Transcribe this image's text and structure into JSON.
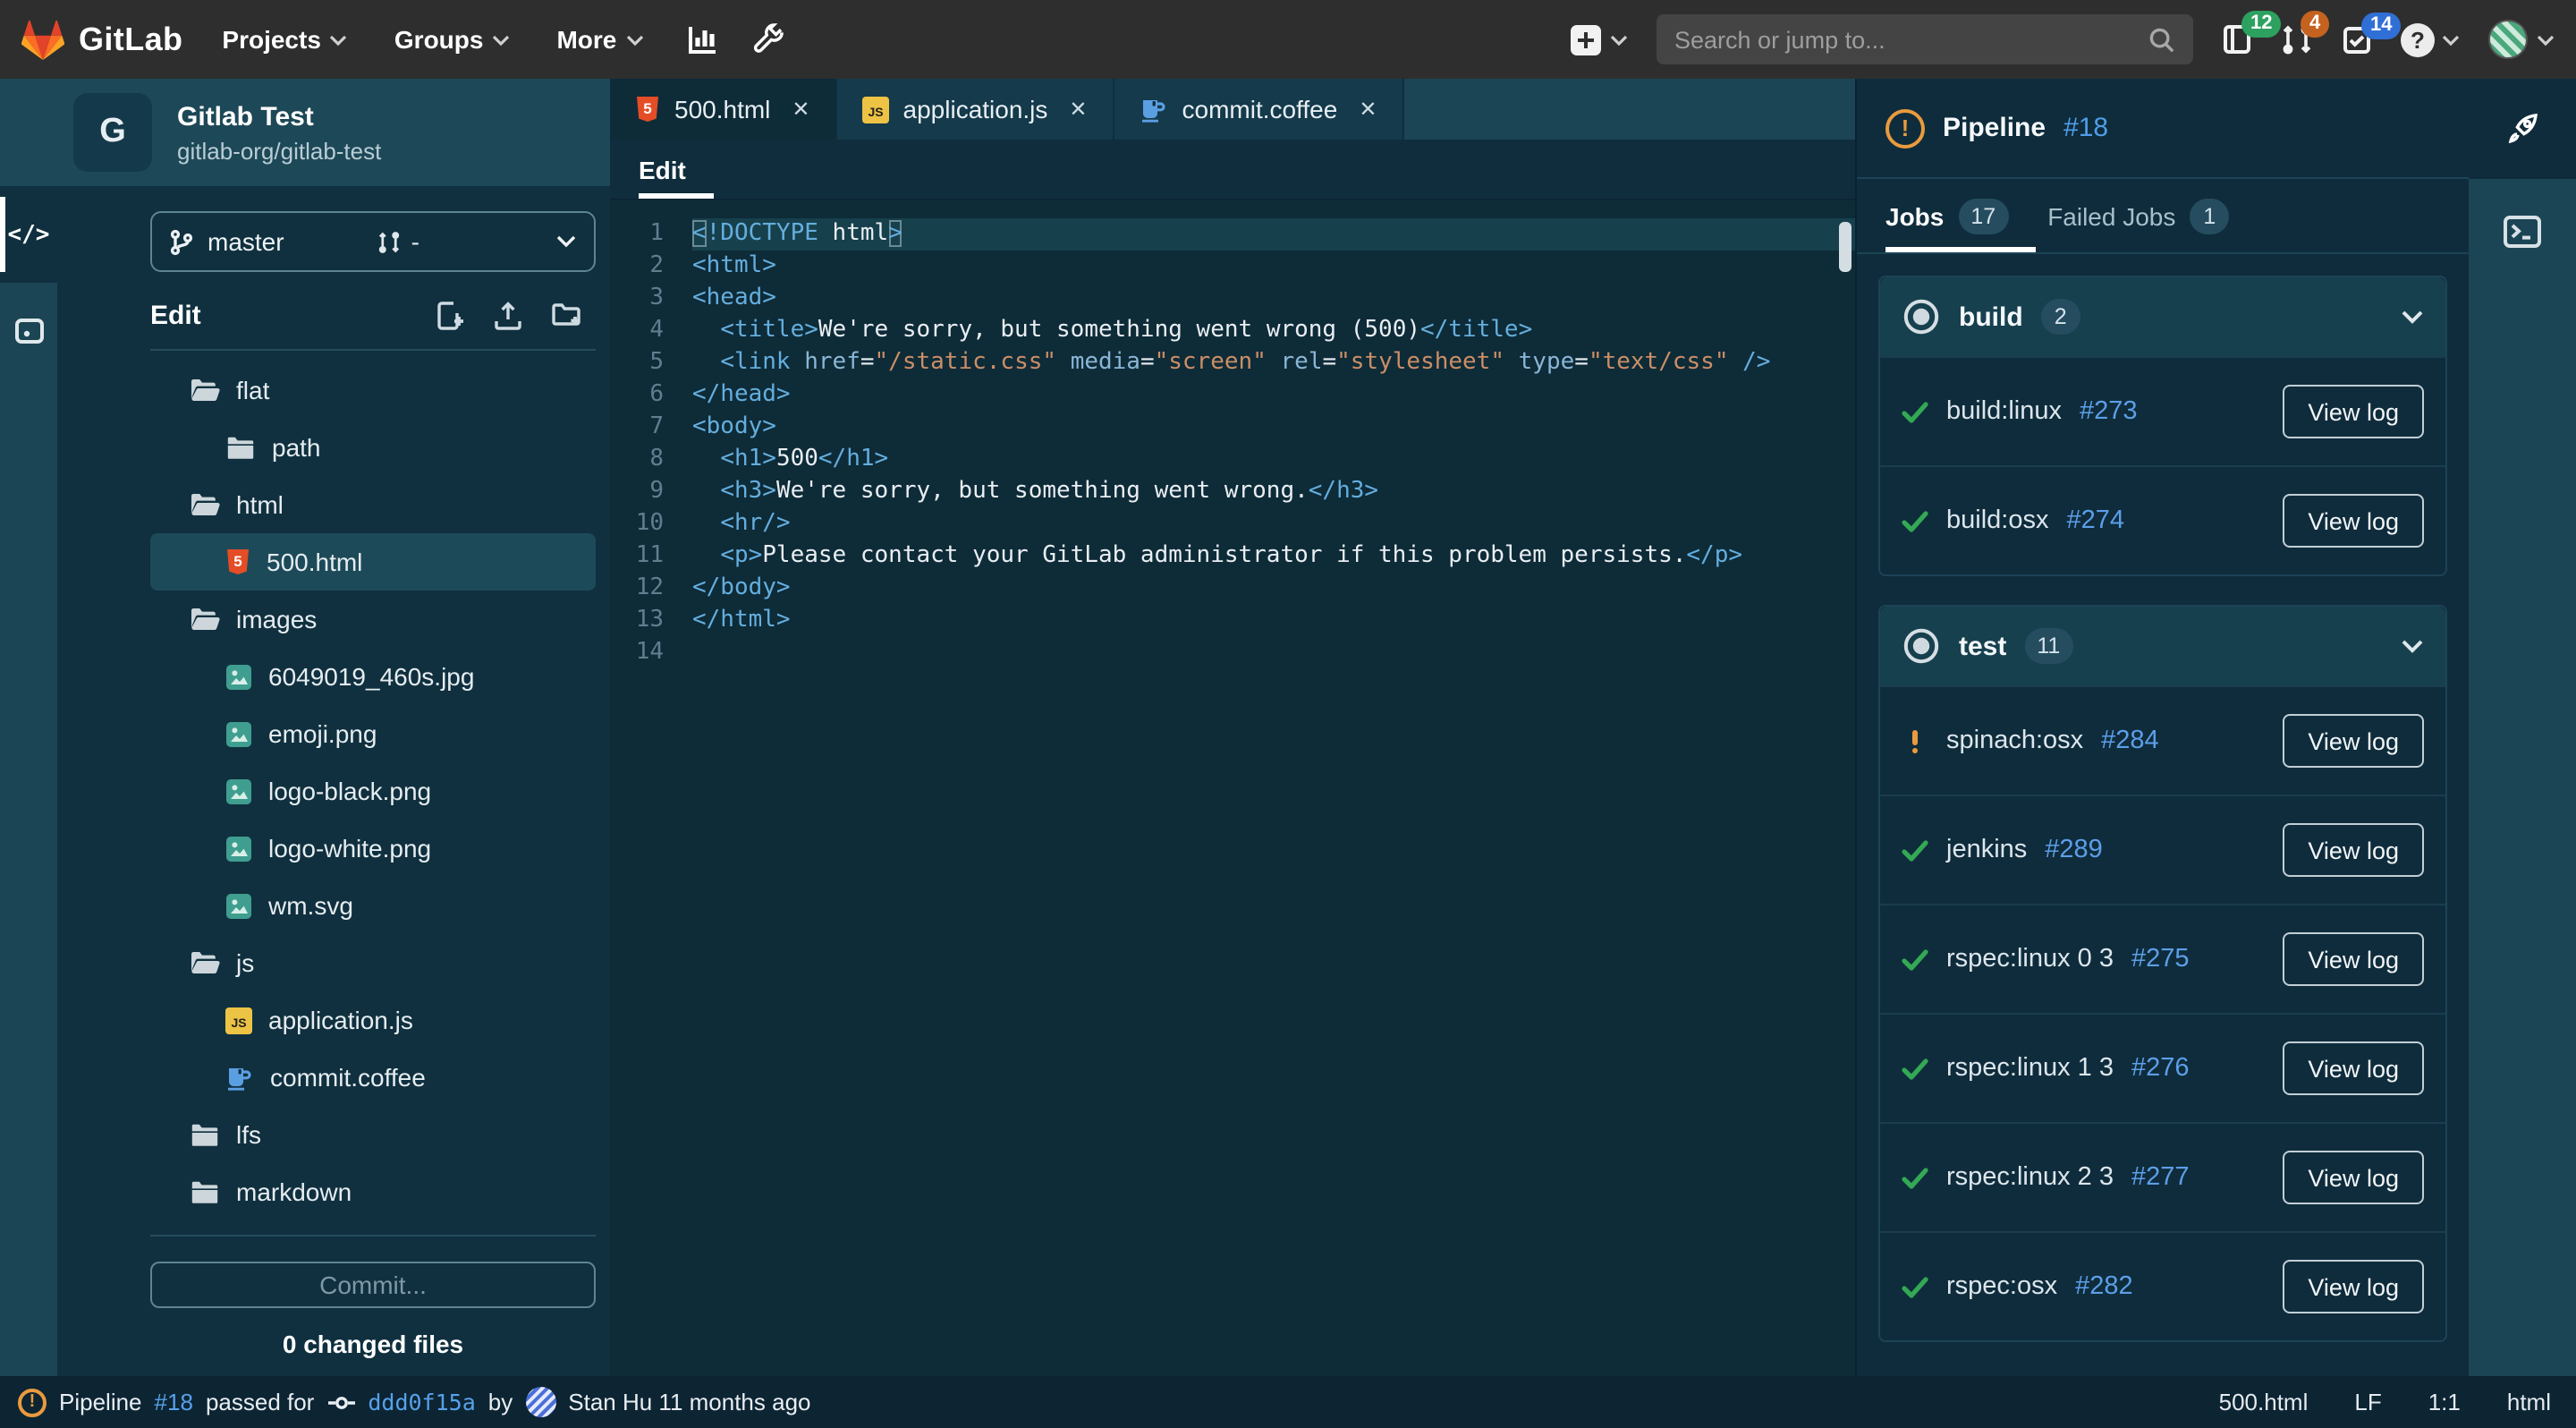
{
  "colors": {
    "topnav_bg": "#2e2e2e",
    "panel_dark": "#0f2c3c",
    "panel_teal": "#1b4554",
    "editor_bg": "#0e2b38",
    "selected_row": "#1d4a59",
    "link_blue": "#5c9fe8",
    "success_green": "#33a954",
    "warning_orange": "#e99b3d",
    "badge_green": "#2da160",
    "badge_orange": "#c4621f",
    "badge_blue": "#306fd6",
    "html5_orange": "#e44d26",
    "js_yellow": "#ecc344",
    "coffee_blue": "#5b9fe3",
    "image_teal": "#3f9e8f"
  },
  "topnav": {
    "brand": "GitLab",
    "menus": [
      {
        "label": "Projects"
      },
      {
        "label": "Groups"
      },
      {
        "label": "More"
      }
    ],
    "search_placeholder": "Search or jump to...",
    "issues_count": "12",
    "mr_count": "4",
    "todo_count": "14"
  },
  "project": {
    "initial": "G",
    "name": "Gitlab Test",
    "path": "gitlab-org/gitlab-test"
  },
  "branch": {
    "name": "master",
    "mr_value": "-"
  },
  "sidebar": {
    "edit_label": "Edit",
    "commit_button": "Commit...",
    "changed_files": "0 changed files"
  },
  "tree": [
    {
      "icon": "folder-open",
      "label": "flat",
      "indent": 0,
      "selected": false
    },
    {
      "icon": "folder",
      "label": "path",
      "indent": 1,
      "selected": false
    },
    {
      "icon": "folder-open",
      "label": "html",
      "indent": 0,
      "selected": false
    },
    {
      "icon": "html5",
      "label": "500.html",
      "indent": 1,
      "selected": true
    },
    {
      "icon": "folder-open",
      "label": "images",
      "indent": 0,
      "selected": false
    },
    {
      "icon": "image",
      "label": "6049019_460s.jpg",
      "indent": 1,
      "selected": false
    },
    {
      "icon": "image",
      "label": "emoji.png",
      "indent": 1,
      "selected": false
    },
    {
      "icon": "image",
      "label": "logo-black.png",
      "indent": 1,
      "selected": false
    },
    {
      "icon": "image",
      "label": "logo-white.png",
      "indent": 1,
      "selected": false
    },
    {
      "icon": "image",
      "label": "wm.svg",
      "indent": 1,
      "selected": false
    },
    {
      "icon": "folder-open",
      "label": "js",
      "indent": 0,
      "selected": false
    },
    {
      "icon": "js",
      "label": "application.js",
      "indent": 1,
      "selected": false
    },
    {
      "icon": "coffee",
      "label": "commit.coffee",
      "indent": 1,
      "selected": false
    },
    {
      "icon": "folder",
      "label": "lfs",
      "indent": 0,
      "selected": false
    },
    {
      "icon": "folder",
      "label": "markdown",
      "indent": 0,
      "selected": false
    }
  ],
  "tabs": [
    {
      "icon": "html5",
      "label": "500.html",
      "close": "✕",
      "active": true
    },
    {
      "icon": "js",
      "label": "application.js",
      "close": "✕",
      "active": false
    },
    {
      "icon": "coffee",
      "label": "commit.coffee",
      "close": "✕",
      "active": false
    }
  ],
  "editor": {
    "mode_tab": "Edit",
    "lines": [
      {
        "n": "1",
        "hl": true,
        "tokens": [
          [
            "b",
            "<"
          ],
          [
            "t",
            "!DOCTYPE"
          ],
          [
            "x",
            " html"
          ],
          [
            "b",
            ">"
          ]
        ]
      },
      {
        "n": "2",
        "hl": false,
        "tokens": [
          [
            "t",
            "<html>"
          ]
        ]
      },
      {
        "n": "3",
        "hl": false,
        "tokens": [
          [
            "t",
            "<head>"
          ]
        ]
      },
      {
        "n": "4",
        "hl": false,
        "tokens": [
          [
            "x",
            "  "
          ],
          [
            "t",
            "<title>"
          ],
          [
            "x",
            "We're sorry, but something went wrong (500)"
          ],
          [
            "t",
            "</title>"
          ]
        ]
      },
      {
        "n": "5",
        "hl": false,
        "tokens": [
          [
            "x",
            "  "
          ],
          [
            "t",
            "<link"
          ],
          [
            "x",
            " "
          ],
          [
            "a",
            "href"
          ],
          [
            "x",
            "="
          ],
          [
            "s",
            "\"/static.css\""
          ],
          [
            "x",
            " "
          ],
          [
            "a",
            "media"
          ],
          [
            "x",
            "="
          ],
          [
            "s",
            "\"screen\""
          ],
          [
            "x",
            " "
          ],
          [
            "a",
            "rel"
          ],
          [
            "x",
            "="
          ],
          [
            "s",
            "\"stylesheet\""
          ],
          [
            "x",
            " "
          ],
          [
            "a",
            "type"
          ],
          [
            "x",
            "="
          ],
          [
            "s",
            "\"text/css\""
          ],
          [
            "x",
            " "
          ],
          [
            "t",
            "/>"
          ]
        ]
      },
      {
        "n": "6",
        "hl": false,
        "tokens": [
          [
            "t",
            "</head>"
          ]
        ]
      },
      {
        "n": "7",
        "hl": false,
        "tokens": [
          [
            "t",
            "<body>"
          ]
        ]
      },
      {
        "n": "8",
        "hl": false,
        "tokens": [
          [
            "x",
            "  "
          ],
          [
            "t",
            "<h1>"
          ],
          [
            "x",
            "500"
          ],
          [
            "t",
            "</h1>"
          ]
        ]
      },
      {
        "n": "9",
        "hl": false,
        "tokens": [
          [
            "x",
            "  "
          ],
          [
            "t",
            "<h3>"
          ],
          [
            "x",
            "We're sorry, but something went wrong."
          ],
          [
            "t",
            "</h3>"
          ]
        ]
      },
      {
        "n": "10",
        "hl": false,
        "tokens": [
          [
            "x",
            "  "
          ],
          [
            "t",
            "<hr/>"
          ]
        ]
      },
      {
        "n": "11",
        "hl": false,
        "tokens": [
          [
            "x",
            "  "
          ],
          [
            "t",
            "<p>"
          ],
          [
            "x",
            "Please contact your GitLab administrator if this problem persists."
          ],
          [
            "t",
            "</p>"
          ]
        ]
      },
      {
        "n": "12",
        "hl": false,
        "tokens": [
          [
            "t",
            "</body>"
          ]
        ]
      },
      {
        "n": "13",
        "hl": false,
        "tokens": [
          [
            "t",
            "</html>"
          ]
        ]
      },
      {
        "n": "14",
        "hl": false,
        "tokens": []
      }
    ]
  },
  "pipeline": {
    "title": "Pipeline",
    "id": "#18",
    "jobs_tab": "Jobs",
    "jobs_count": "17",
    "failed_tab": "Failed Jobs",
    "failed_count": "1",
    "view_log_label": "View log",
    "groups": [
      {
        "name": "build",
        "count": "2",
        "jobs": [
          {
            "status": "success",
            "name": "build:linux",
            "id": "#273"
          },
          {
            "status": "success",
            "name": "build:osx",
            "id": "#274"
          }
        ]
      },
      {
        "name": "test",
        "count": "11",
        "jobs": [
          {
            "status": "warning",
            "name": "spinach:osx",
            "id": "#284"
          },
          {
            "status": "success",
            "name": "jenkins",
            "id": "#289"
          },
          {
            "status": "success",
            "name": "rspec:linux 0 3",
            "id": "#275"
          },
          {
            "status": "success",
            "name": "rspec:linux 1 3",
            "id": "#276"
          },
          {
            "status": "success",
            "name": "rspec:linux 2 3",
            "id": "#277"
          },
          {
            "status": "success",
            "name": "rspec:osx",
            "id": "#282"
          }
        ]
      }
    ]
  },
  "statusbar": {
    "pipeline_word": "Pipeline",
    "pipeline_id": "#18",
    "passed_for": "passed for",
    "commit_sha": "ddd0f15a",
    "by_word": "by",
    "author": "Stan Hu 11 months ago",
    "right_items": [
      "500.html",
      "LF",
      "1:1",
      "html"
    ]
  }
}
